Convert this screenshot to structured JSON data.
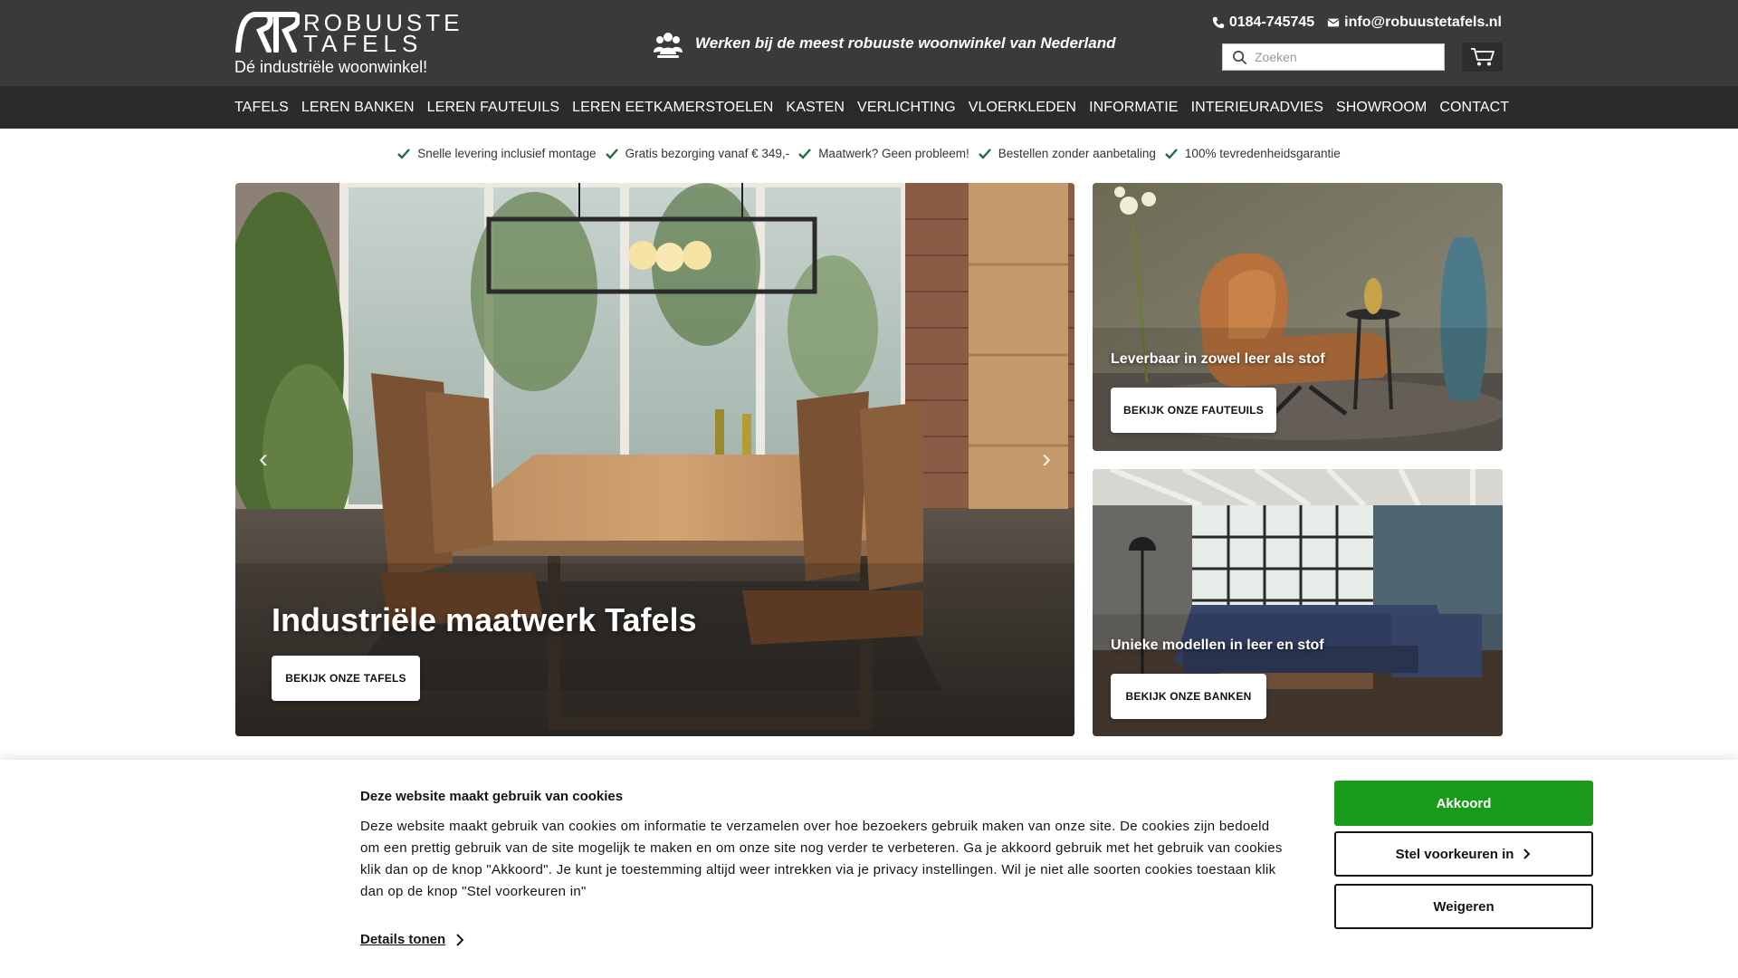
{
  "brand": {
    "name_line1": "ROBUUSTE",
    "name_line2": "TAFELS",
    "tagline": "Dé industriële woonwinkel!"
  },
  "header": {
    "jobs_text": "Werken bij de meest robuuste woonwinkel van Nederland",
    "phone": "0184-745745",
    "email": "info@robuustetafels.nl",
    "search_placeholder": "Zoeken"
  },
  "nav": {
    "items": [
      {
        "label": "TAFELS"
      },
      {
        "label": "LEREN BANKEN"
      },
      {
        "label": "LEREN FAUTEUILS"
      },
      {
        "label": "LEREN EETKAMERSTOELEN"
      },
      {
        "label": "KASTEN"
      },
      {
        "label": "VERLICHTING"
      },
      {
        "label": "VLOERKLEDEN"
      },
      {
        "label": "INFORMATIE"
      },
      {
        "label": "INTERIEURADVIES"
      },
      {
        "label": "SHOWROOM"
      },
      {
        "label": "CONTACT"
      }
    ]
  },
  "usps": [
    {
      "label": "Snelle levering inclusief montage"
    },
    {
      "label": "Gratis bezorging vanaf € 349,-"
    },
    {
      "label": "Maatwerk? Geen probleem!"
    },
    {
      "label": "Bestellen zonder aanbetaling"
    },
    {
      "label": "100% tevredenheidsgarantie"
    }
  ],
  "hero": {
    "main": {
      "title": "Industriële maatwerk Tafels",
      "button": "BEKIJK ONZE TAFELS"
    },
    "side1": {
      "caption": "Leverbaar in zowel leer als stof",
      "button": "BEKIJK ONZE FAUTEUILS"
    },
    "side2": {
      "caption": "Unieke modellen in leer en stof",
      "button": "BEKIJK ONZE BANKEN"
    }
  },
  "cookie": {
    "title": "Deze website maakt gebruik van cookies",
    "text": "Deze website maakt gebruik van cookies om informatie te verzamelen over hoe bezoekers gebruik maken van onze site. De cookies zijn bedoeld om een prettig gebruik van de site mogelijk te maken en om onze site nog verder te verbeteren. Ga je akkoord gebruik met het gebruik van cookies klik dan op de knop \"Akkoord\". Je kunt je toestemming altijd weer intrekken via je privacy instellingen. Wil je niet alle soorten cookies toestaan klik dan op de knop \"Stel voorkeuren in\"",
    "details_link": "Details tonen",
    "accept_label": "Akkoord",
    "prefs_label": "Stel voorkeuren in",
    "deny_label": "Weigeren"
  },
  "colors": {
    "header_bg": "#3a3a3a",
    "nav_bg": "#2b2b2b",
    "accept_green": "#1a9a1a",
    "check_green": "#1f6e3c"
  }
}
